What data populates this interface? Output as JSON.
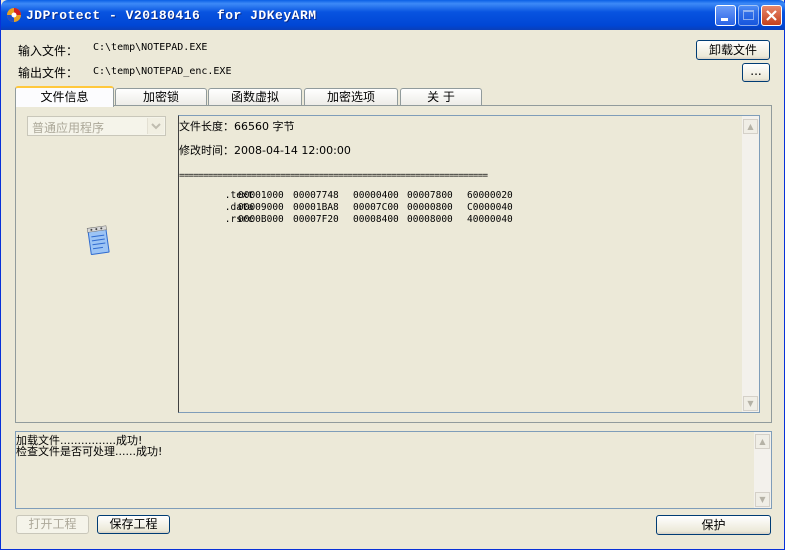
{
  "window": {
    "title": "JDProtect - V20180416  for JDKeyARM",
    "controls": [
      "minimize-icon",
      "maximize-icon",
      "close-icon"
    ]
  },
  "files": {
    "input_label": "输入文件：",
    "input_path": "C:\\temp\\NOTEPAD.EXE",
    "output_label": "输出文件：",
    "output_path": "C:\\temp\\NOTEPAD_enc.EXE",
    "unload_button": "卸载文件",
    "browse_button": "..."
  },
  "tabs": [
    {
      "label": "文件信息",
      "active": true
    },
    {
      "label": "加密锁",
      "active": false
    },
    {
      "label": "函数虚拟",
      "active": false
    },
    {
      "label": "加密选项",
      "active": false
    },
    {
      "label": "关  于",
      "active": false
    }
  ],
  "file_info": {
    "app_type": "普通应用程序",
    "length_line": "文件长度：66560 字节",
    "mtime_line": "修改时间：2008-04-14 12:00:00",
    "separator": "================================================================",
    "sections": [
      {
        "name": ".text",
        "c1": "00001000",
        "c2": "00007748",
        "c3": "00000400",
        "c4": "00007800",
        "c5": "60000020"
      },
      {
        "name": ".data",
        "c1": "00009000",
        "c2": "00001BA8",
        "c3": "00007C00",
        "c4": "00000800",
        "c5": "C0000040"
      },
      {
        "name": ".rsrc",
        "c1": "0000B000",
        "c2": "00007F20",
        "c3": "00008400",
        "c4": "00008000",
        "c5": "40000040"
      }
    ]
  },
  "log": [
    "加载文件................成功!",
    "检查文件是否可处理......成功!"
  ],
  "bottom": {
    "open_project": "打开工程",
    "save_project": "保存工程",
    "protect": "保护"
  }
}
